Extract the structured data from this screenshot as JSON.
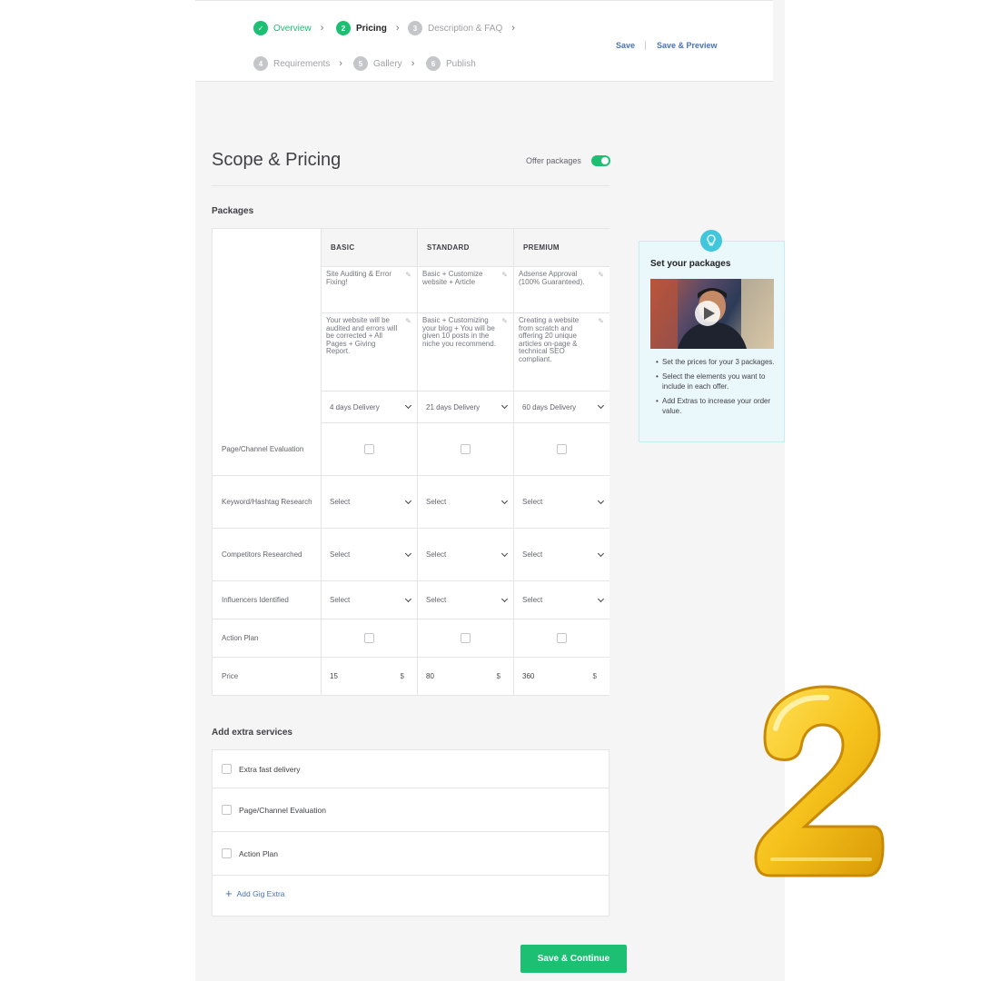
{
  "steps": [
    {
      "num": "✓",
      "label": "Overview",
      "state": "done"
    },
    {
      "num": "2",
      "label": "Pricing",
      "state": "active"
    },
    {
      "num": "3",
      "label": "Description & FAQ",
      "state": "pending"
    },
    {
      "num": "4",
      "label": "Requirements",
      "state": "pending"
    },
    {
      "num": "5",
      "label": "Gallery",
      "state": "pending"
    },
    {
      "num": "6",
      "label": "Publish",
      "state": "pending"
    }
  ],
  "topbar": {
    "save": "Save",
    "save_preview": "Save & Preview"
  },
  "section": {
    "title": "Scope & Pricing",
    "offer_packages_label": "Offer packages",
    "offer_packages_on": true,
    "packages_label": "Packages"
  },
  "packages": {
    "headers": [
      "BASIC",
      "STANDARD",
      "PREMIUM"
    ],
    "names": [
      "Site Auditing & Error Fixing!",
      "Basic + Customize website + Article",
      "Adsense Approval (100% Guaranteed)."
    ],
    "descriptions": [
      "Your website will be audited and errors will be corrected + All Pages + Giving Report.",
      "Basic + Customizing your blog + You will be given 10 posts in the niche you recommend.",
      "Creating a website from scratch and offering 20 unique articles on-page & technical SEO compliant."
    ],
    "delivery": [
      "4 days Delivery",
      "21 days Delivery",
      "60 days Delivery"
    ],
    "rows": [
      {
        "label": "Page/Channel Evaluation",
        "type": "checkbox"
      },
      {
        "label": "Keyword/Hashtag Research",
        "type": "select",
        "values": [
          "Select",
          "Select",
          "Select"
        ]
      },
      {
        "label": "Competitors Researched",
        "type": "select",
        "values": [
          "Select",
          "Select",
          "Select"
        ]
      },
      {
        "label": "Influencers Identified",
        "type": "select",
        "values": [
          "Select",
          "Select",
          "Select"
        ]
      },
      {
        "label": "Action Plan",
        "type": "checkbox"
      }
    ],
    "price_label": "Price",
    "prices": [
      "15",
      "80",
      "360"
    ],
    "currency": "$"
  },
  "tip": {
    "title": "Set your packages",
    "bullets": [
      "Set the prices for your 3 packages.",
      "Select the elements you want to include in each offer.",
      "Add Extras to increase your order value."
    ]
  },
  "extras": {
    "title": "Add extra services",
    "items": [
      "Extra fast delivery",
      "Page/Channel Evaluation",
      "Action Plan"
    ],
    "add_label": "Add Gig Extra"
  },
  "save_continue": "Save & Continue",
  "colors": {
    "accent": "#1dbf73",
    "link": "#4a73b3",
    "tip_bg": "#eaf8fb",
    "balloon": "#f6c21c"
  },
  "decoration": {
    "balloon_digit": "2"
  }
}
